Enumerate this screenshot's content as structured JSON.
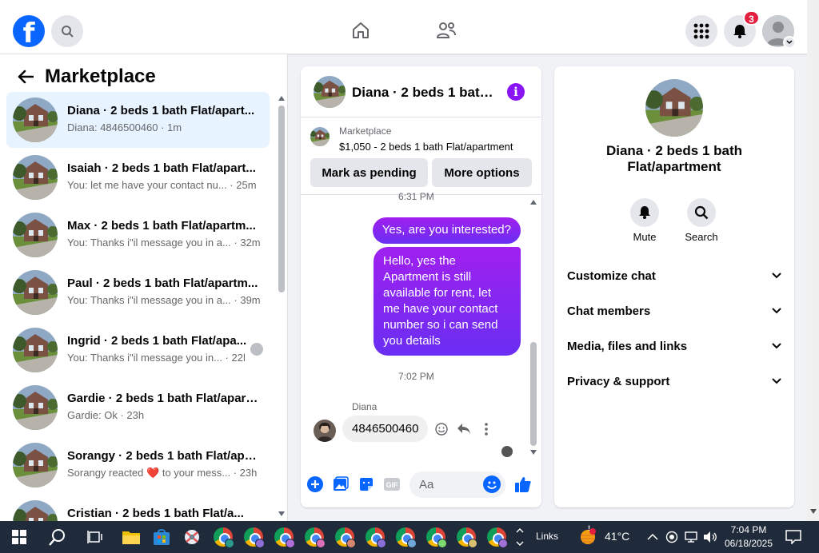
{
  "topbar": {
    "logo_letter": "f",
    "notification_count": "3"
  },
  "sidebar": {
    "title": "Marketplace",
    "conversations": [
      {
        "name": "Diana · 2 beds 1 bath Flat/apart...",
        "subtitle": "Diana: 4846500460 · 1m",
        "active": true
      },
      {
        "name": "Isaiah · 2 beds 1 bath Flat/apart...",
        "subtitle": "You: let me have your contact nu... · 25m"
      },
      {
        "name": "Max · 2 beds 1 bath Flat/apartm...",
        "subtitle": "You: Thanks i\"il message you in a... · 32m"
      },
      {
        "name": "Paul · 2 beds 1 bath Flat/apartm...",
        "subtitle": "You: Thanks i\"il message you in a... · 39m"
      },
      {
        "name": "Ingrid · 2 beds 1 bath Flat/apa...",
        "subtitle": "You: Thanks i\"il message you in... · 22h"
      },
      {
        "name": "Gardie · 2 beds 1 bath Flat/apart...",
        "subtitle": "Gardie: Ok · 23h"
      },
      {
        "name": "Sorangy · 2 beds 1 bath Flat/apa...",
        "subtitle_pre": "Sorangy reacted",
        "subtitle_emoji": "❤️",
        "subtitle_post": "to your mess... · 23h"
      },
      {
        "name": "Cristian · 2 beds 1 bath Flat/a...",
        "subtitle": ""
      }
    ]
  },
  "chat": {
    "title": "Diana · 2 beds 1 bath Flat/apartment",
    "listing_source": "Marketplace",
    "listing_price": "$1,050 - 2 beds 1 bath Flat/apartment",
    "mark_pending_label": "Mark as pending",
    "more_options_label": "More options",
    "time_top": "6:31 PM",
    "outgoing_1": "Yes, are you interested?",
    "outgoing_2": "Hello, yes the Apartment is still available for rent, let me have your contact number so i can send you details",
    "time_mid": "7:02 PM",
    "sender": "Diana",
    "incoming_1": "4846500460",
    "composer_placeholder": "Aa",
    "accent": "#8a14f5"
  },
  "info_panel": {
    "title": "Diana · 2 beds 1 bath Flat/apartment",
    "actions": [
      {
        "label": "Mute",
        "icon": "bell-icon"
      },
      {
        "label": "Search",
        "icon": "search-icon"
      }
    ],
    "sections": [
      "Customize chat",
      "Chat members",
      "Media, files and links",
      "Privacy & support"
    ]
  },
  "taskbar": {
    "links_label": "Links",
    "temperature": "41°C",
    "time": "7:04 PM",
    "date": "06/18/2025",
    "weather_alert": "!"
  },
  "colors": {
    "facebook_blue": "#0866ff",
    "messenger_purple": "#8a14f5",
    "active_row": "#e7f3ff",
    "notification_red": "#e41e3f"
  }
}
